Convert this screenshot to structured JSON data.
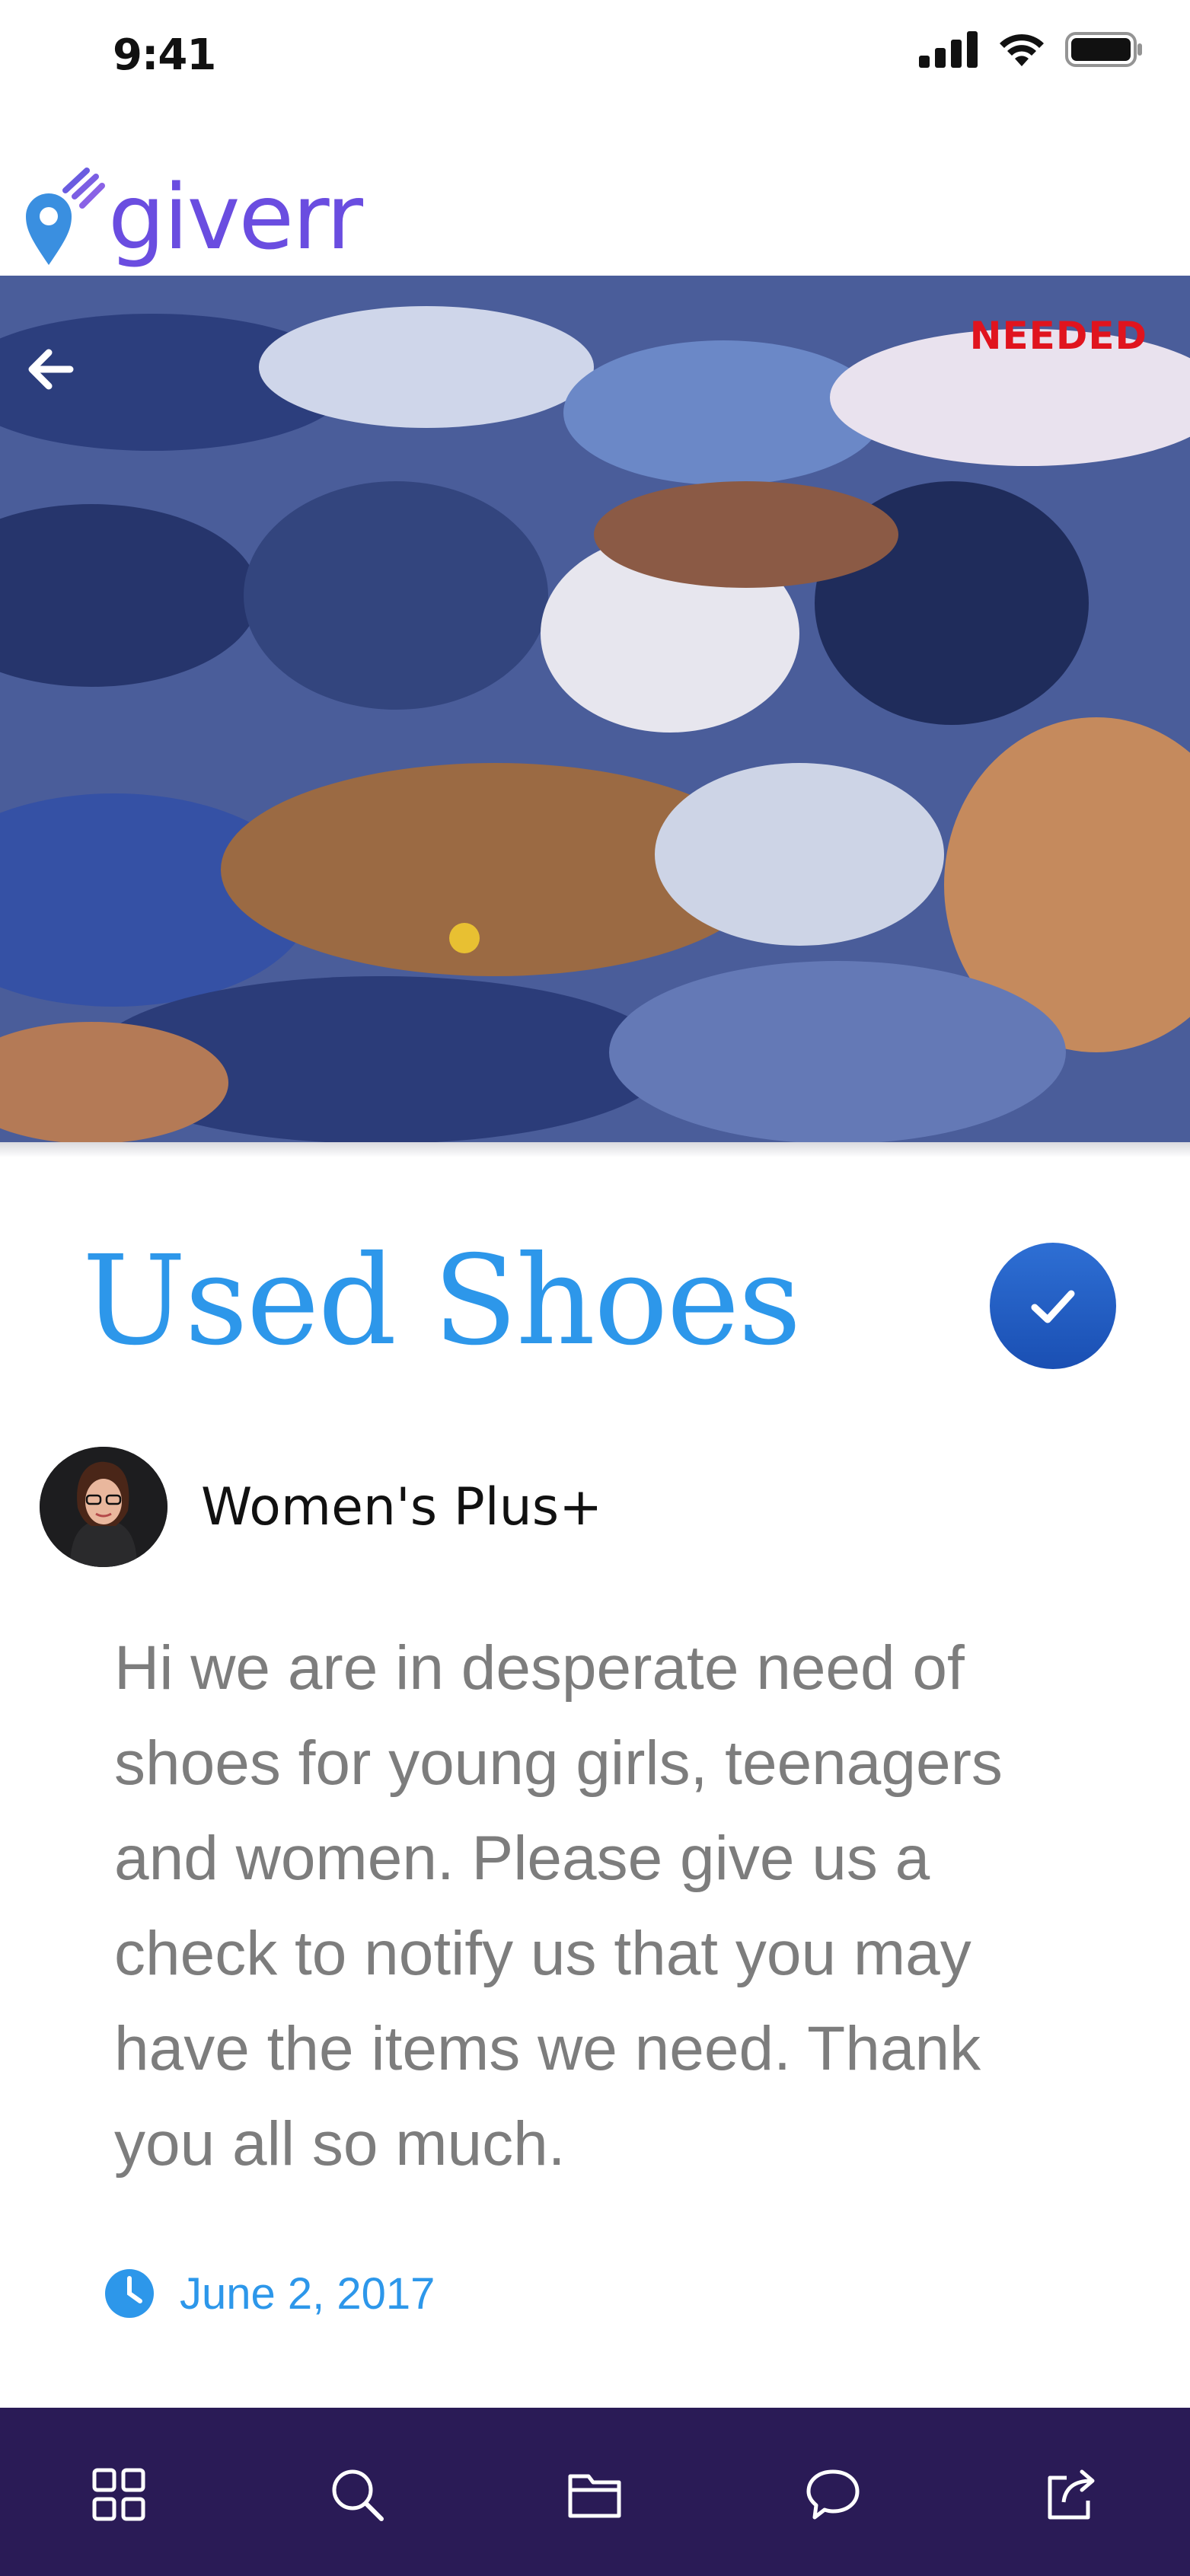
{
  "status_bar": {
    "time": "9:41",
    "icons": [
      "signal-icon",
      "wifi-icon",
      "battery-icon"
    ]
  },
  "brand": {
    "name": "giverr",
    "icon": "location-pin-icon",
    "colors": {
      "pin": "#3a8fe0",
      "text": "#6a4de0"
    }
  },
  "hero": {
    "image": "pile-of-shoes-photo",
    "badge": "NEEDED",
    "badge_color": "#e0141e",
    "back_icon": "arrow-left-icon"
  },
  "post": {
    "title": "Used Shoes",
    "title_color": "#2d97ea",
    "action_icon": "checkmark-icon",
    "author": {
      "name": "Women's Plus+",
      "avatar": "avatar-photo"
    },
    "description": "Hi we are in desperate need of shoes for young girls, teenagers and women. Please give us a check to notify us that you may have the items we need. Thank you all so much.",
    "date": "June 2, 2017",
    "date_icon": "clock-icon"
  },
  "tabbar": {
    "background": "#2a1b56",
    "items": [
      {
        "icon": "grid-icon"
      },
      {
        "icon": "search-icon"
      },
      {
        "icon": "folder-icon"
      },
      {
        "icon": "chat-bubble-icon"
      },
      {
        "icon": "share-icon"
      }
    ]
  }
}
